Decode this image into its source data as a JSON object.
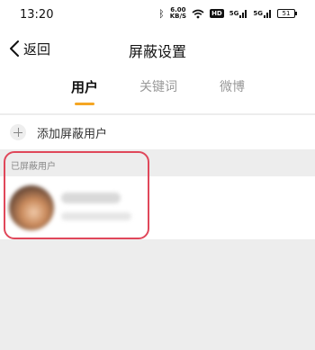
{
  "status_bar": {
    "time": "13:20",
    "network_speed_value": "6.00",
    "network_speed_unit": "KB/S",
    "hd_label": "HD",
    "sim1_label": "5G",
    "sim2_label": "5G",
    "battery": "51",
    "icons": [
      "bluetooth-icon",
      "wifi-icon",
      "signal-icon",
      "battery-icon"
    ]
  },
  "nav": {
    "back_label": "返回",
    "title": "屏蔽设置"
  },
  "tabs": [
    {
      "label": "用户",
      "active": true
    },
    {
      "label": "关键词",
      "active": false
    },
    {
      "label": "微博",
      "active": false
    }
  ],
  "add_row": {
    "label": "添加屏蔽用户",
    "icon": "plus-icon"
  },
  "blocked_section": {
    "header": "已屏蔽用户",
    "users": [
      {
        "name": "",
        "meta": ""
      }
    ]
  },
  "colors": {
    "accent": "#f5a623",
    "highlight": "#e0475a",
    "background": "#ededed"
  }
}
